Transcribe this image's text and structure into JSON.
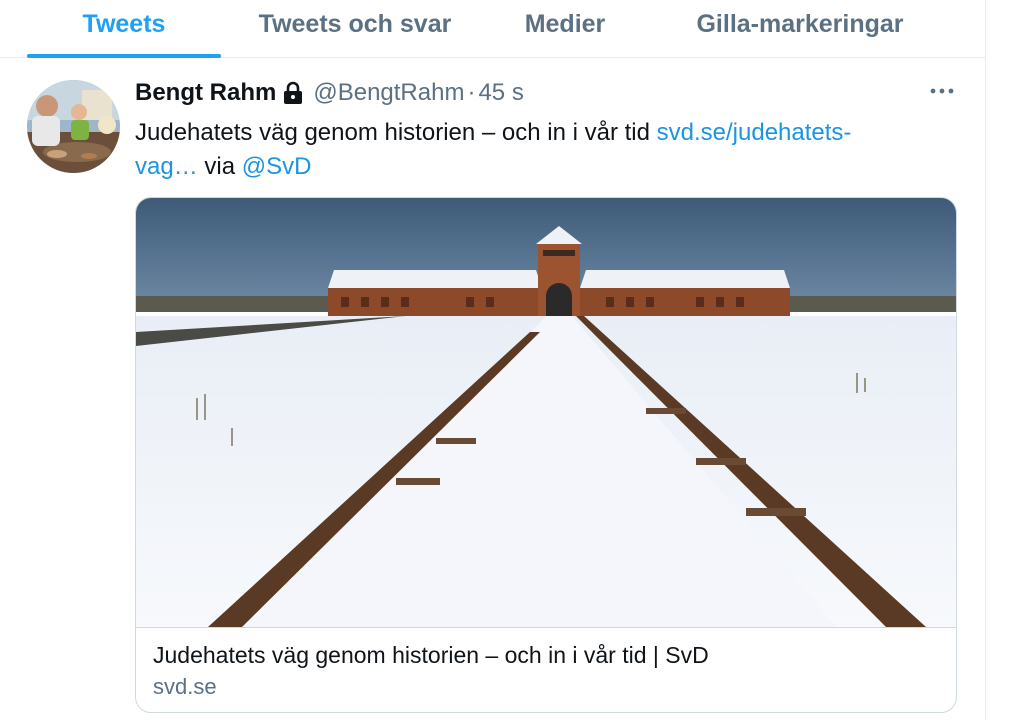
{
  "tabs": [
    {
      "label": "Tweets",
      "active": true
    },
    {
      "label": "Tweets och svar",
      "active": false
    },
    {
      "label": "Medier",
      "active": false
    },
    {
      "label": "Gilla-markeringar",
      "active": false
    }
  ],
  "tweet": {
    "author_name": "Bengt Rahm",
    "protected_icon": "lock-icon",
    "handle": "@BengtRahm",
    "separator": "·",
    "time": "45 s",
    "text_main": "Judehatets väg genom historien – och in i vår tid ",
    "link_text_part1": "svd.se/judehatets-",
    "link_text_part2": "vag…",
    "via_text": " via ",
    "mention": "@SvD",
    "more_icon": "more-horizontal-icon"
  },
  "card": {
    "title": "Judehatets väg genom historien – och in i vår tid | SvD",
    "domain": "svd.se",
    "image_description_icon": "railway-photo"
  },
  "colors": {
    "accent": "#1da1f2",
    "link": "#1b95e0",
    "secondary_text": "#5b7083",
    "border": "#e6ecf0"
  }
}
